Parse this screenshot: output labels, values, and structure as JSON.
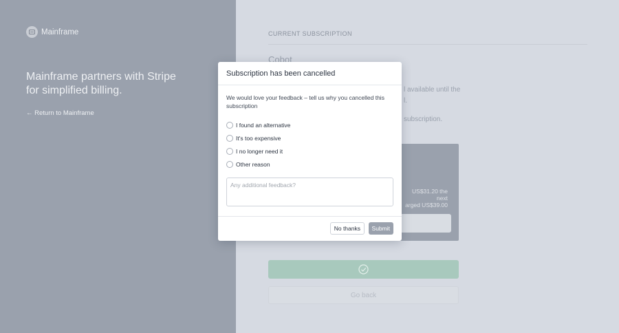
{
  "brand": {
    "name": "Mainframe",
    "tagline": "Mainframe partners with Stripe for simplified billing.",
    "back_link": "← Return to Mainframe"
  },
  "background": {
    "section_label": "CURRENT SUBSCRIPTION",
    "plan_name": "Cobot",
    "notice_fragment_1": "l available until the",
    "notice_fragment_1b": "l.",
    "notice_fragment_2": "subscription.",
    "card_text_line1": "US$31.20 the next",
    "card_text_line2": "arged US$39.00",
    "go_back_label": "Go back"
  },
  "modal": {
    "title": "Subscription has been cancelled",
    "prompt": "We would love your feedback – tell us why you cancelled this subscription",
    "options": [
      {
        "label": "I found an alternative"
      },
      {
        "label": "It's too expensive"
      },
      {
        "label": "I no longer need it"
      },
      {
        "label": "Other reason"
      }
    ],
    "feedback_placeholder": "Any additional feedback?",
    "no_thanks_label": "No thanks",
    "submit_label": "Submit"
  },
  "colors": {
    "left_panel": "#9aa1ad",
    "right_panel": "#d6dae2",
    "confirm_green": "#a8c9bd",
    "submit_button": "#9aa1ad"
  }
}
